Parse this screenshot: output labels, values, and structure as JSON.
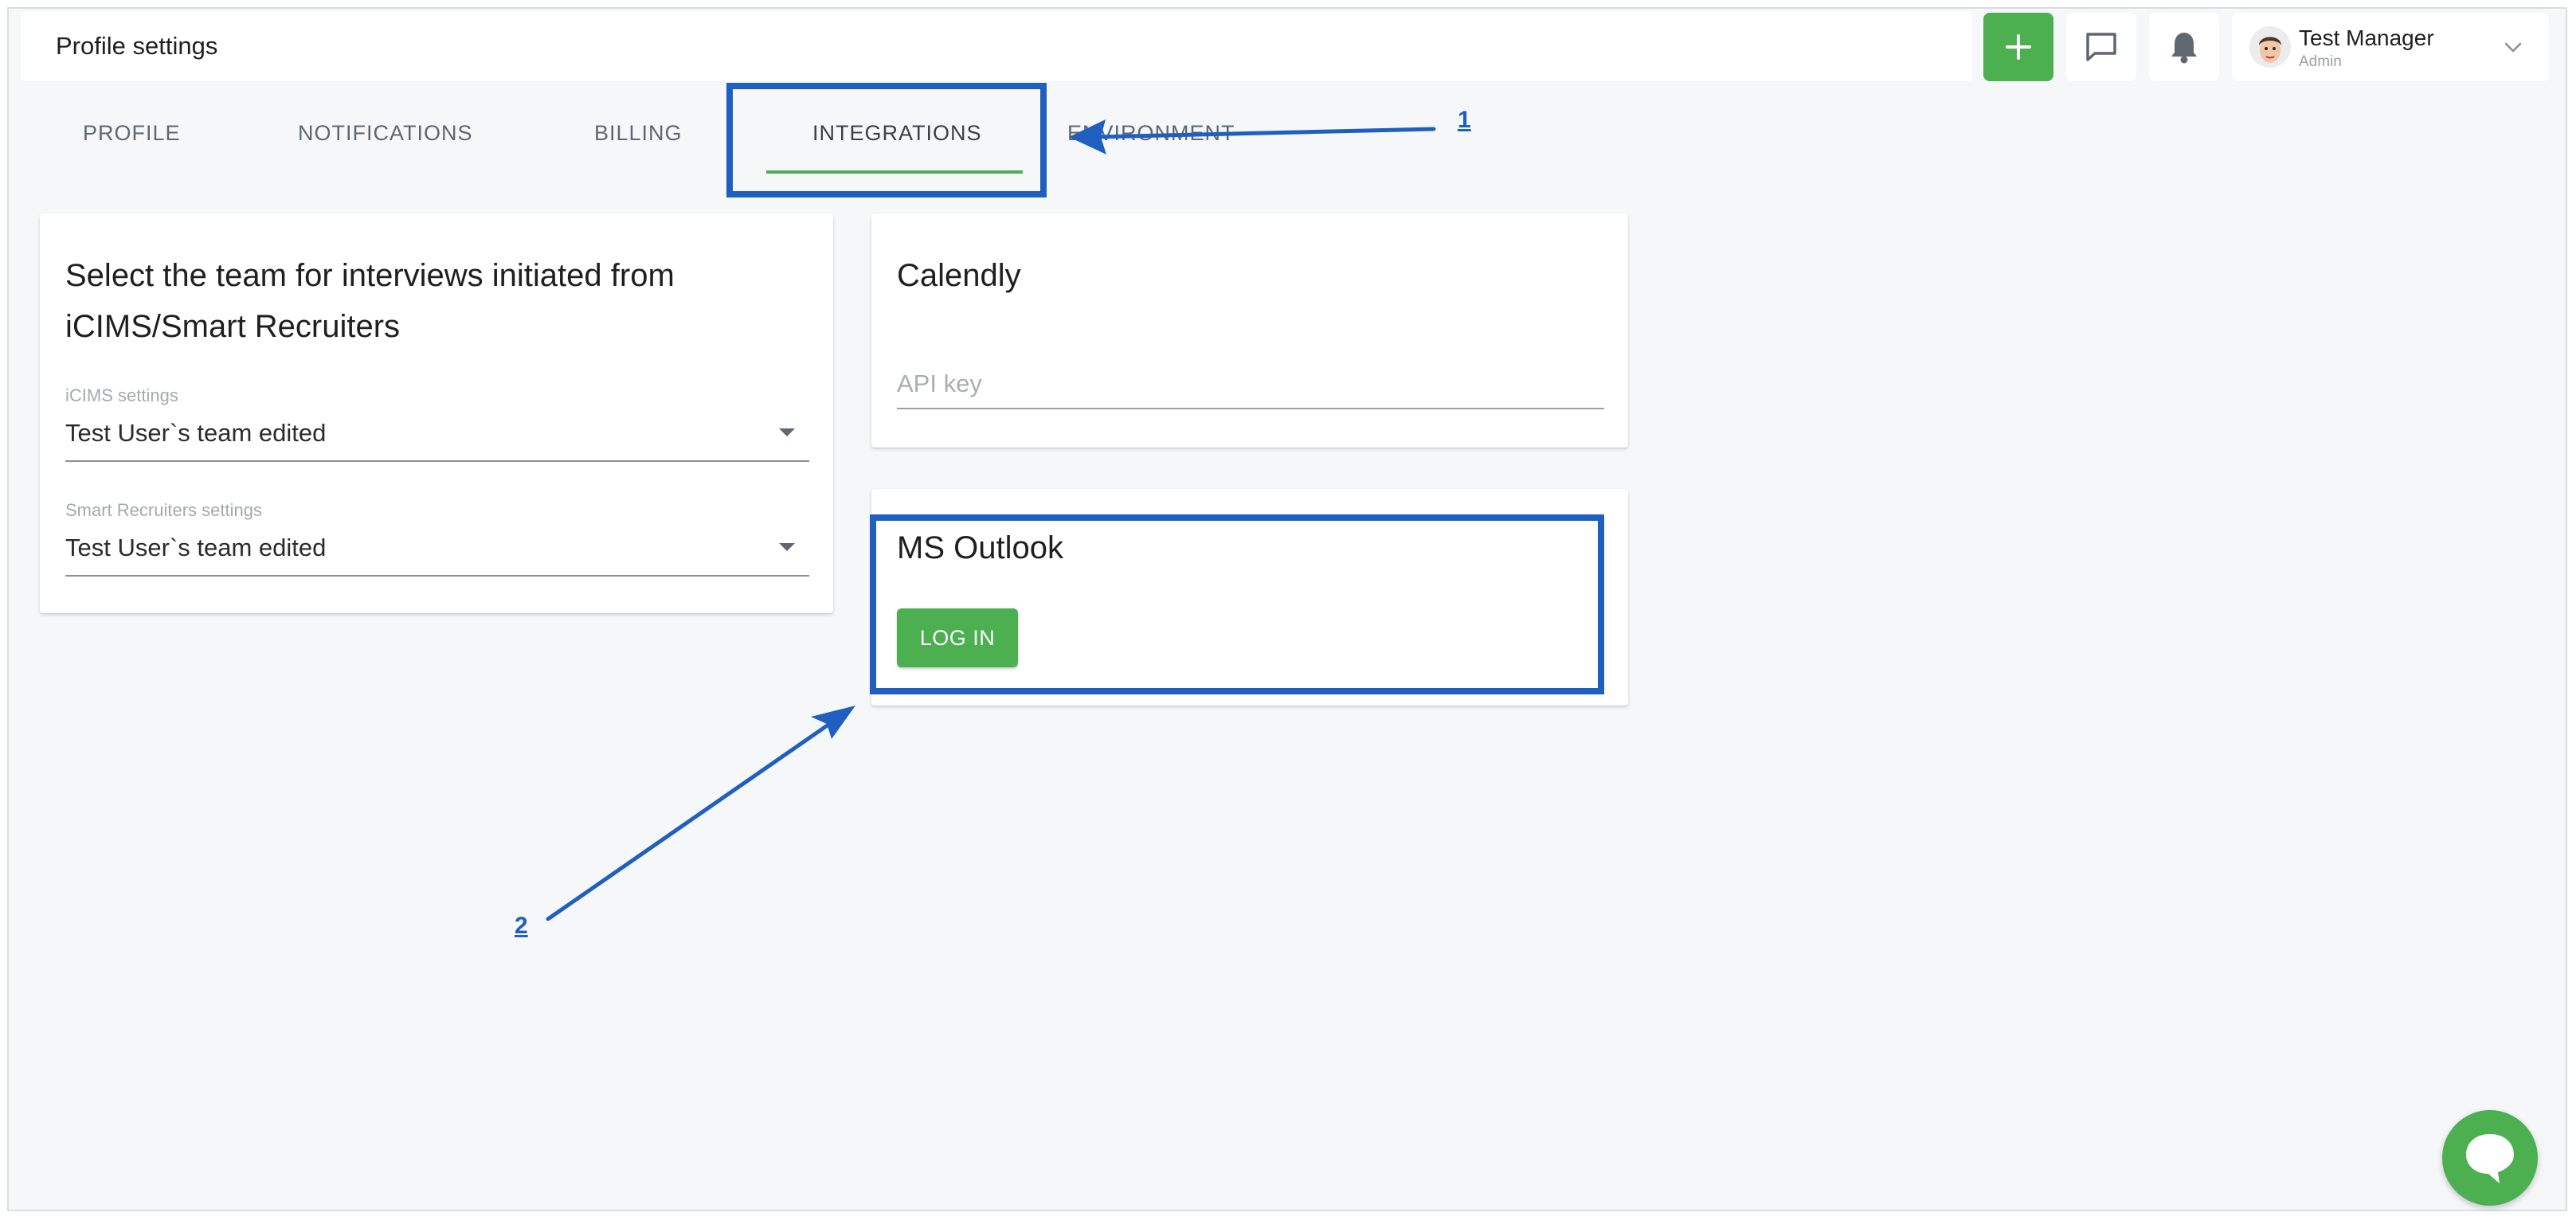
{
  "header": {
    "title": "Profile settings",
    "user": {
      "name": "Test Manager",
      "role": "Admin"
    }
  },
  "tabs": [
    "PROFILE",
    "NOTIFICATIONS",
    "BILLING",
    "INTEGRATIONS",
    "ENVIRONMENT"
  ],
  "active_tab": "INTEGRATIONS",
  "icims_card": {
    "title_line1": "Select the team for interviews initiated from",
    "title_line2": "iCIMS/Smart Recruiters",
    "icims_label": "iCIMS settings",
    "icims_value": "Test User`s team edited",
    "smart_label": "Smart Recruiters settings",
    "smart_value": "Test User`s team edited"
  },
  "calendly_card": {
    "title": "Calendly",
    "api_key_placeholder": "API key"
  },
  "outlook_card": {
    "title": "MS Outlook",
    "login_label": "LOG IN"
  },
  "annotations": {
    "one": "1",
    "two": "2"
  },
  "colors": {
    "accent": "#4caf50",
    "annotation": "#1f5fbf",
    "background": "#f5f7f9"
  },
  "icons": [
    "plus-icon",
    "chat-icon",
    "bell-icon",
    "avatar",
    "chevron-down-icon",
    "dropdown-arrow-icon",
    "chat-bubble-icon"
  ]
}
